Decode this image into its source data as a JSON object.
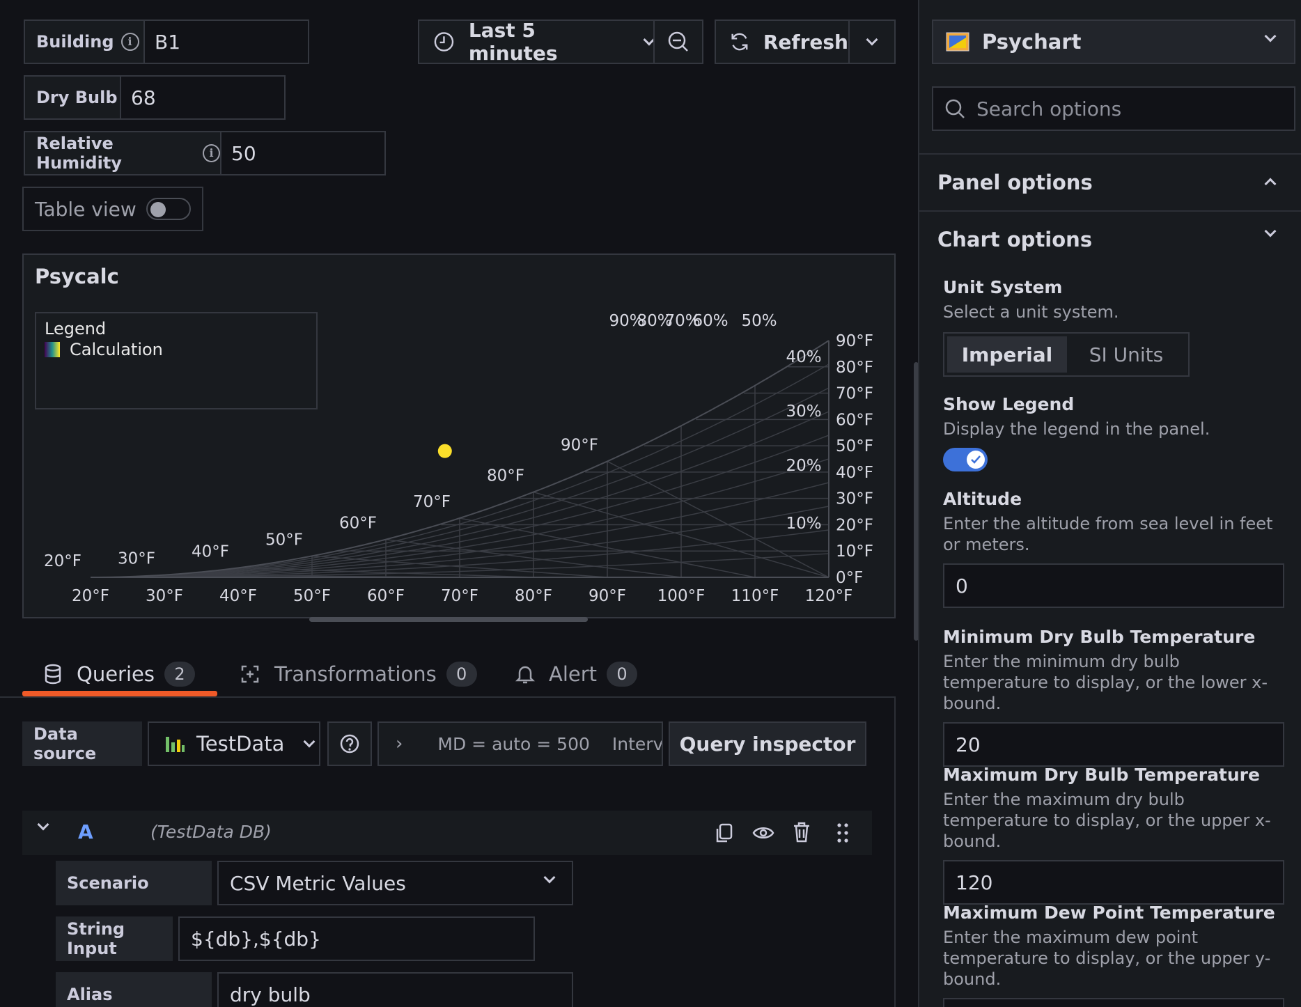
{
  "variables": {
    "building": {
      "label": "Building",
      "value": "B1"
    },
    "dry_bulb": {
      "label": "Dry Bulb",
      "value": "68"
    },
    "relative_humidity": {
      "label": "Relative Humidity",
      "value": "50"
    },
    "table_view": {
      "label": "Table view",
      "on": false
    }
  },
  "time_picker": {
    "range": "Last 5 minutes",
    "refresh": "Refresh"
  },
  "panel": {
    "title": "Psycalc",
    "legend_title": "Legend",
    "legend_item": "Calculation"
  },
  "chart_data": {
    "type": "scatter",
    "x_ticks": [
      "20°F",
      "30°F",
      "40°F",
      "50°F",
      "60°F",
      "70°F",
      "80°F",
      "90°F",
      "100°F",
      "110°F",
      "120°F"
    ],
    "y_ticks": [
      "0°F",
      "10°F",
      "20°F",
      "30°F",
      "40°F",
      "50°F",
      "60°F",
      "70°F",
      "80°F",
      "90°F"
    ],
    "saturation_labels": [
      "20°F",
      "30°F",
      "40°F",
      "50°F",
      "60°F",
      "70°F",
      "80°F",
      "90°F"
    ],
    "rh_labels_top": [
      "90%",
      "80%",
      "70%",
      "60%",
      "50%"
    ],
    "rh_labels_right": [
      "40%",
      "30%",
      "20%",
      "10%"
    ],
    "xlim": [
      20,
      120
    ],
    "ylim": [
      0,
      90
    ],
    "points": [
      {
        "x": 68,
        "y": 48
      }
    ],
    "point_color": "#fade2a"
  },
  "tabs": [
    {
      "label": "Queries",
      "count": "2"
    },
    {
      "label": "Transformations",
      "count": "0"
    },
    {
      "label": "Alert",
      "count": "0"
    }
  ],
  "query_bar": {
    "data_source_label": "Data source",
    "data_source": "TestData",
    "options_text": "MD = auto = 500",
    "interval_text": "Interva",
    "inspector": "Query inspector"
  },
  "query": {
    "ref": "A",
    "db": "(TestData DB)",
    "scenario_label": "Scenario",
    "scenario": "CSV Metric Values",
    "string_input_label": "String Input",
    "string_input": "${db},${db}",
    "alias_label": "Alias",
    "alias": "dry bulb"
  },
  "options_pane": {
    "visualization": "Psychart",
    "search_placeholder": "Search options",
    "panel_options": "Panel options",
    "chart_options": "Chart options",
    "unit_system": {
      "title": "Unit System",
      "desc": "Select a unit system.",
      "options": [
        "Imperial",
        "SI Units"
      ],
      "selected": "Imperial"
    },
    "show_legend": {
      "title": "Show Legend",
      "desc": "Display the legend in the panel.",
      "on": true
    },
    "altitude": {
      "title": "Altitude",
      "desc": "Enter the altitude from sea level in feet or meters.",
      "value": "0"
    },
    "min_db": {
      "title": "Minimum Dry Bulb Temperature",
      "desc": "Enter the minimum dry bulb temperature to display, or the lower x-bound.",
      "value": "20"
    },
    "max_db": {
      "title": "Maximum Dry Bulb Temperature",
      "desc": "Enter the maximum dry bulb temperature to display, or the upper x-bound.",
      "value": "120"
    },
    "max_dp": {
      "title": "Maximum Dew Point Temperature",
      "desc": "Enter the maximum dew point temperature to display, or the upper y-bound."
    }
  },
  "colors": {
    "accent": "#3d71d9",
    "tab_underline": "#f05a28",
    "bg": "#111217"
  }
}
